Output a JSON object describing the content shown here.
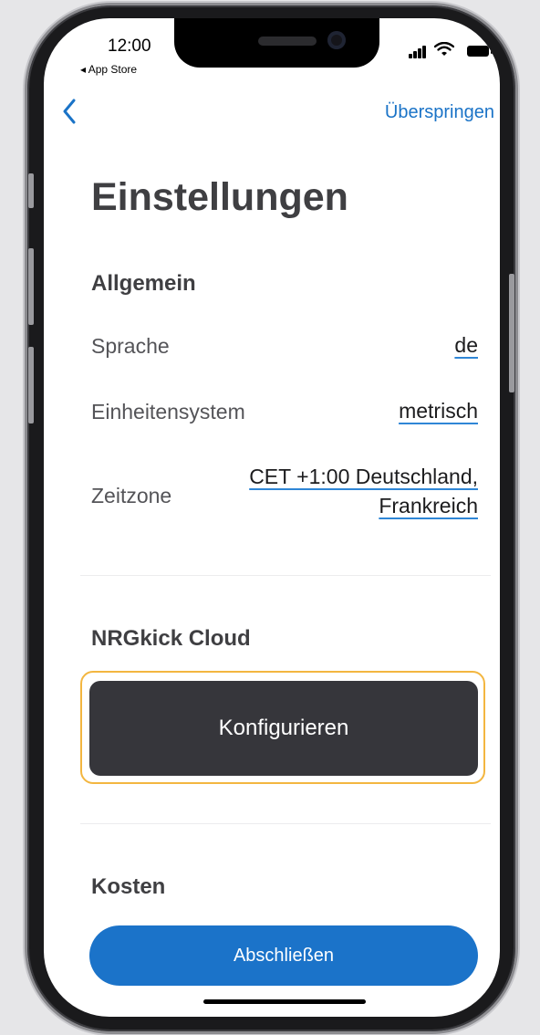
{
  "status_bar": {
    "time": "12:00",
    "back_app": "◂ App Store"
  },
  "nav": {
    "back_icon": "chevron-left-icon",
    "skip_label": "Überspringen"
  },
  "title": "Einstellungen",
  "general": {
    "heading": "Allgemein",
    "language_label": "Sprache",
    "language_value": "de",
    "units_label": "Einheitensystem",
    "units_value": "metrisch",
    "timezone_label": "Zeitzone",
    "timezone_value_line1": "CET +1:00 Deutschland,",
    "timezone_value_line2": "Frankreich"
  },
  "cloud": {
    "heading": "NRGkick Cloud",
    "configure_label": "Konfigurieren"
  },
  "costs": {
    "heading": "Kosten"
  },
  "finish_label": "Abschließen",
  "colors": {
    "accent": "#1b73c9",
    "dark_button": "#36363b",
    "focus_ring": "#f3b640"
  }
}
